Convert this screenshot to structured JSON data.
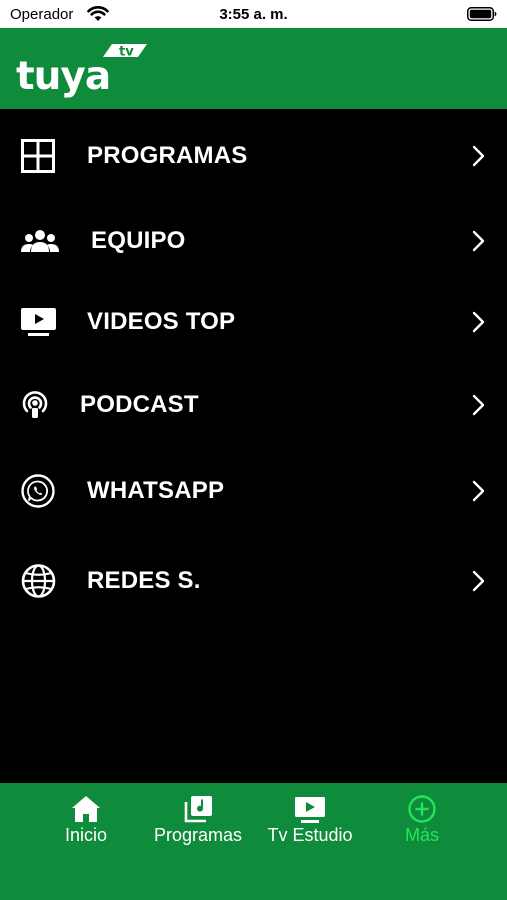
{
  "status_bar": {
    "carrier": "Operador",
    "time": "3:55 a. m.",
    "wifi_icon": "wifi-icon",
    "battery_icon": "battery-icon"
  },
  "header": {
    "logo_text": "tuya",
    "logo_badge": "tv",
    "brand_color": "#0f8c3b"
  },
  "menu": {
    "items": [
      {
        "label": "PROGRAMAS",
        "icon": "grid-icon"
      },
      {
        "label": "EQUIPO",
        "icon": "group-icon"
      },
      {
        "label": "VIDEOS TOP",
        "icon": "tv-play-icon"
      },
      {
        "label": "PODCAST",
        "icon": "podcast-icon"
      },
      {
        "label": "WHATSAPP",
        "icon": "whatsapp-icon"
      },
      {
        "label": "REDES S.",
        "icon": "globe-icon"
      }
    ]
  },
  "tab_bar": {
    "active_color": "#21e45a",
    "tabs": [
      {
        "label": "Inicio",
        "icon": "home-icon"
      },
      {
        "label": "Programas",
        "icon": "music-library-icon"
      },
      {
        "label": "Tv Estudio",
        "icon": "tv-play-icon"
      },
      {
        "label": "Más",
        "icon": "plus-circle-icon"
      }
    ],
    "active_tab": "Más"
  }
}
